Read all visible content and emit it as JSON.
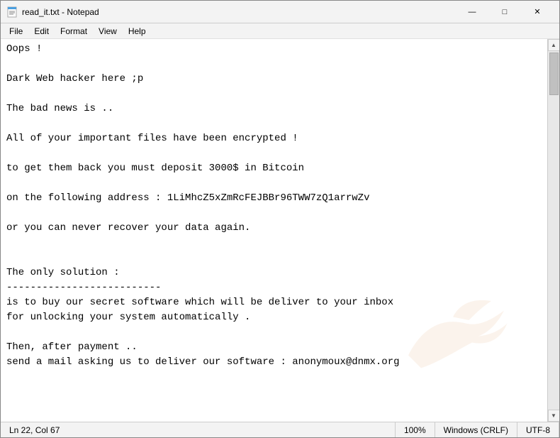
{
  "window": {
    "title": "read_it.txt - Notepad",
    "icon": "notepad-icon"
  },
  "titlebar": {
    "minimize_label": "—",
    "maximize_label": "□",
    "close_label": "✕"
  },
  "menu": {
    "items": [
      "File",
      "Edit",
      "Format",
      "View",
      "Help"
    ]
  },
  "content": {
    "text": "Oops !\n\nDark Web hacker here ;p\n\nThe bad news is ..\n\nAll of your important files have been encrypted !\n\nto get them back you must deposit 3000$ in Bitcoin\n\non the following address : 1LiMhcZ5xZmRcFEJBBr96TWW7zQ1arrwZv\n\nor you can never recover your data again.\n\n\nThe only solution :\n--------------------------\nis to buy our secret software which will be deliver to your inbox\nfor unlocking your system automatically .\n\nThen, after payment ..\nsend a mail asking us to deliver our software : anonymoux@dnmx.org"
  },
  "statusbar": {
    "position": "Ln 22, Col 67",
    "zoom": "100%",
    "line_ending": "Windows (CRLF)",
    "encoding": "UTF-8"
  }
}
